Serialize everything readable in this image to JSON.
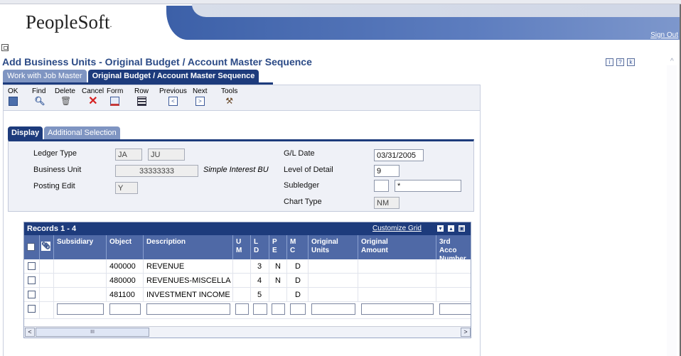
{
  "header": {
    "logo": "PeopleSoft",
    "logo_mark": ".",
    "signout": "Sign Out"
  },
  "page_title": "Add Business Units - Original Budget / Account Master Sequence",
  "top_tabs": [
    {
      "label": "Work with Job Master",
      "active": false
    },
    {
      "label": "Original Budget / Account Master Sequence",
      "active": true
    }
  ],
  "toolbar": {
    "ok": "OK",
    "find": "Find",
    "delete": "Delete",
    "cancel": "Cancel",
    "form": "Form",
    "row": "Row",
    "previous": "Previous",
    "next": "Next",
    "tools": "Tools"
  },
  "form_tabs": [
    {
      "label": "Display",
      "active": true
    },
    {
      "label": "Additional Selection",
      "active": false
    }
  ],
  "form": {
    "ledger_type_label": "Ledger Type",
    "ledger_type_1": "JA",
    "ledger_type_2": "JU",
    "business_unit_label": "Business Unit",
    "business_unit": "33333333",
    "business_unit_desc": "Simple Interest BU",
    "posting_edit_label": "Posting Edit",
    "posting_edit": "Y",
    "gl_date_label": "G/L Date",
    "gl_date": "03/31/2005",
    "level_of_detail_label": "Level of Detail",
    "level_of_detail": "9",
    "subledger_label": "Subledger",
    "subledger_type": "",
    "subledger": "*",
    "chart_type_label": "Chart Type",
    "chart_type": "NM"
  },
  "grid": {
    "title": "Records 1 - 4",
    "customize": "Customize Grid",
    "headers": {
      "subsidiary": "Subsidiary",
      "object": "Object",
      "description": "Description",
      "um1": "U",
      "um2": "M",
      "ld1": "L",
      "ld2": "D",
      "pe1": "P",
      "pe2": "E",
      "mc1": "M",
      "mc2": "C",
      "orig_units1": "Original",
      "orig_units2": "Units",
      "orig_amount1": "Original",
      "orig_amount2": "Amount",
      "third1": "3rd Acco",
      "third2": "Number"
    },
    "rows": [
      {
        "object": "400000",
        "description": "REVENUE",
        "ld": "3",
        "pe": "N",
        "mc": "D"
      },
      {
        "object": "480000",
        "description": "REVENUES-MISCELLA",
        "ld": "4",
        "pe": "N",
        "mc": "D"
      },
      {
        "object": "481100",
        "description": "INVESTMENT INCOME",
        "ld": "5",
        "pe": "",
        "mc": "D"
      }
    ],
    "scroll_thumb": "III"
  },
  "colors": {
    "accent": "#1d3b7c",
    "header_grad": "#3c60a8",
    "cancel": "#d62020"
  }
}
